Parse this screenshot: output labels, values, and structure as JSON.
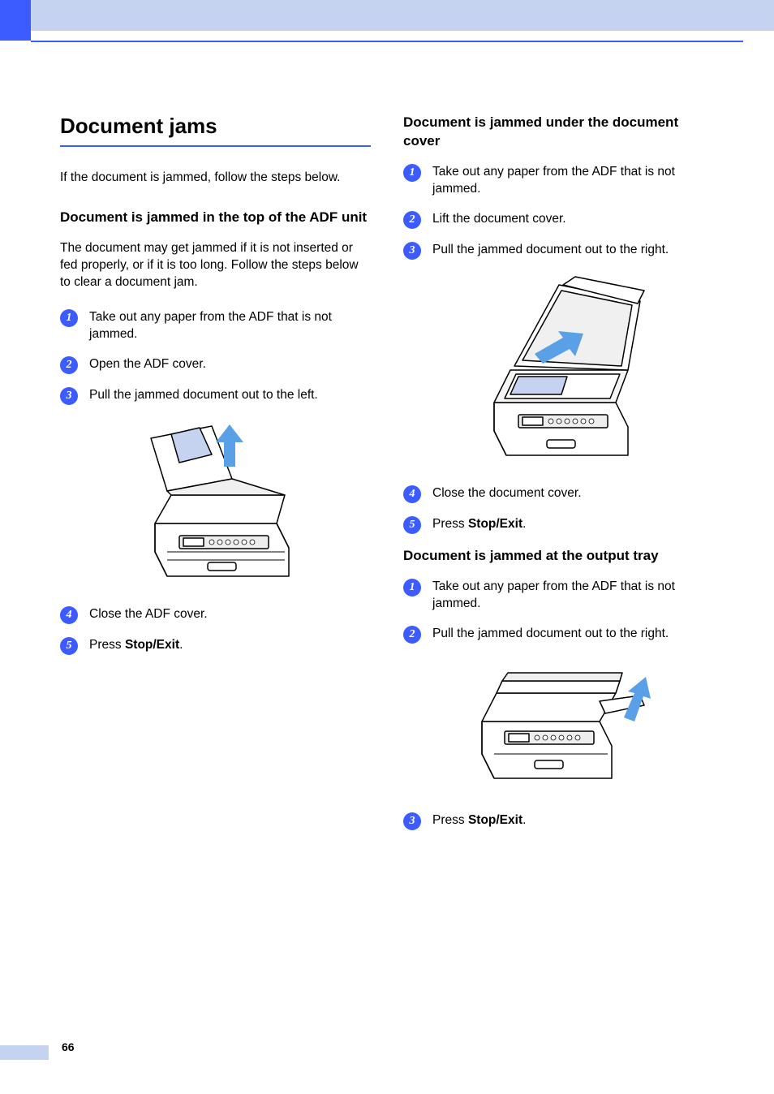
{
  "pageNumber": "66",
  "left": {
    "title": "Document jams",
    "intro": "If the document is jammed, follow the steps below.",
    "section1": {
      "heading": "Document is jammed in the top of the ADF unit",
      "intro": "The document may get jammed if it is not inserted or fed properly, or if it is too long. Follow the steps below to clear a document jam.",
      "steps": {
        "s1": "Take out any paper from the ADF that is not jammed.",
        "s2": "Open the ADF cover.",
        "s3": "Pull the jammed document out to the left.",
        "s4": "Close the ADF cover.",
        "s5_prefix": "Press ",
        "s5_bold": "Stop/Exit",
        "s5_suffix": "."
      }
    }
  },
  "right": {
    "section2": {
      "heading": "Document is jammed under the document cover",
      "steps": {
        "s1": "Take out any paper from the ADF that is not jammed.",
        "s2": "Lift the document cover.",
        "s3": "Pull the jammed document out to the right.",
        "s4": "Close the document cover.",
        "s5_prefix": "Press ",
        "s5_bold": "Stop/Exit",
        "s5_suffix": "."
      }
    },
    "section3": {
      "heading": "Document is jammed at the output tray",
      "steps": {
        "s1": "Take out any paper from the ADF that is not jammed.",
        "s2": "Pull the jammed document out to the right.",
        "s3_prefix": "Press ",
        "s3_bold": "Stop/Exit",
        "s3_suffix": "."
      }
    }
  }
}
